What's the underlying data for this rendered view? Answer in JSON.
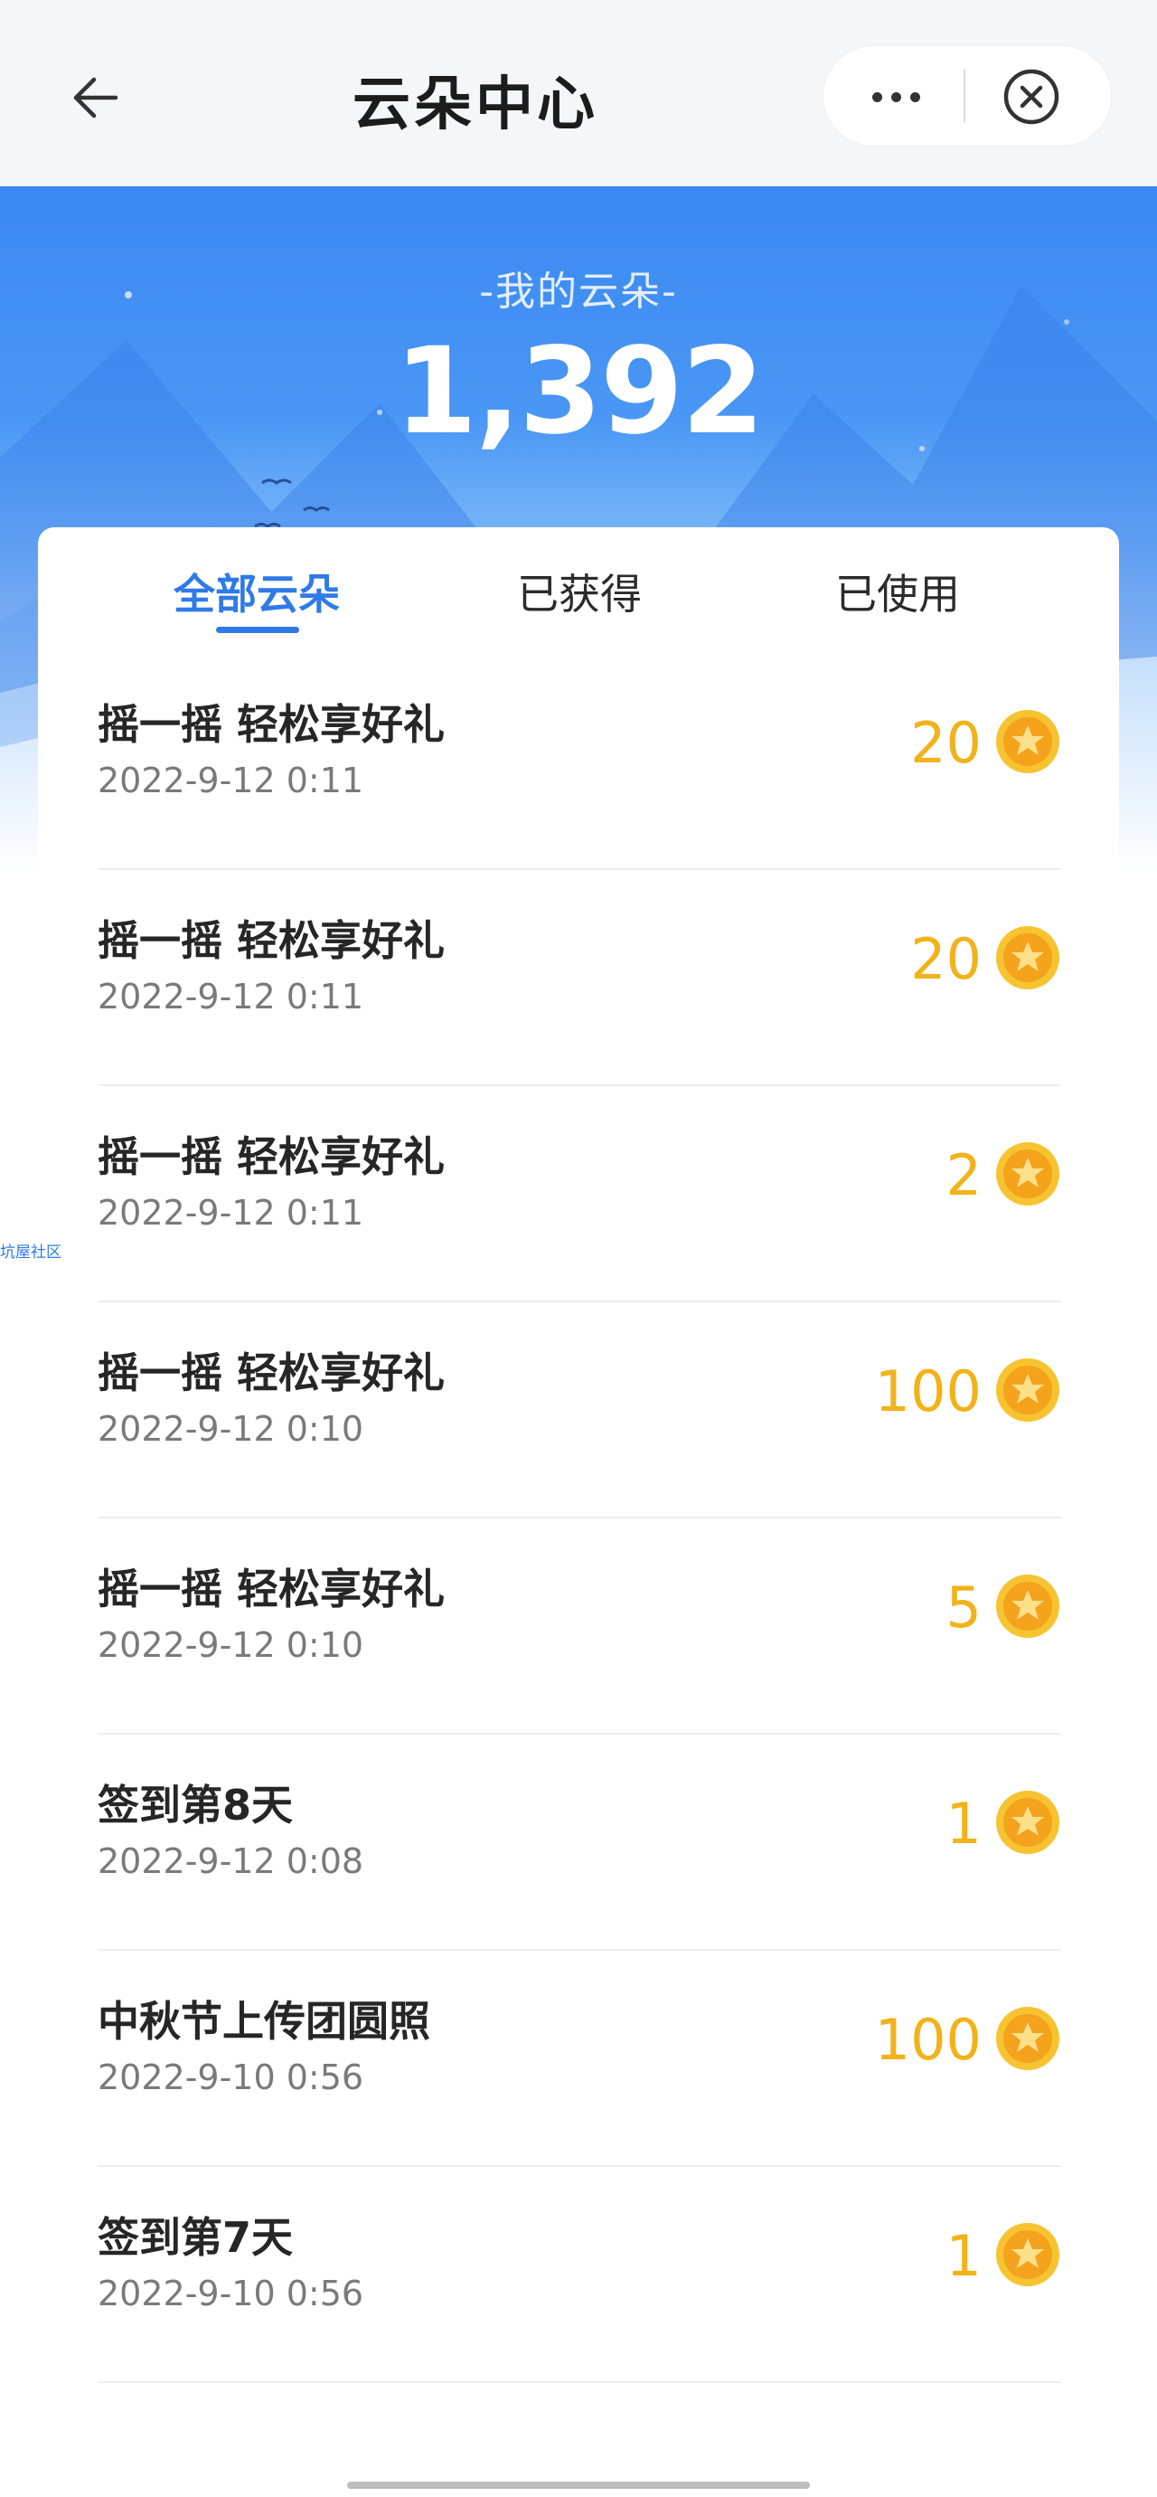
{
  "header": {
    "title": "云朵中心",
    "back_icon": "arrow-left-icon",
    "more_icon": "more-dots-icon",
    "close_icon": "close-circle-icon"
  },
  "balance": {
    "label": "-我的云朵-",
    "value": "1,392"
  },
  "tabs": [
    {
      "label": "全部云朵",
      "active": true
    },
    {
      "label": "已获得",
      "active": false
    },
    {
      "label": "已使用",
      "active": false
    }
  ],
  "records": [
    {
      "title": "摇一摇 轻松享好礼",
      "time": "2022-9-12 0:11",
      "amount": "20"
    },
    {
      "title": "摇一摇 轻松享好礼",
      "time": "2022-9-12 0:11",
      "amount": "20"
    },
    {
      "title": "摇一摇 轻松享好礼",
      "time": "2022-9-12 0:11",
      "amount": "2"
    },
    {
      "title": "摇一摇 轻松享好礼",
      "time": "2022-9-12 0:10",
      "amount": "100"
    },
    {
      "title": "摇一摇 轻松享好礼",
      "time": "2022-9-12 0:10",
      "amount": "5"
    },
    {
      "title": "签到第8天",
      "time": "2022-9-12 0:08",
      "amount": "1"
    },
    {
      "title": "中秋节上传团圆照",
      "time": "2022-9-10 0:56",
      "amount": "100"
    },
    {
      "title": "签到第7天",
      "time": "2022-9-10 0:56",
      "amount": "1"
    }
  ],
  "side_tag": "坑屋社区",
  "colors": {
    "accent_blue": "#2f7ae8",
    "coin_gold": "#f2b21a",
    "hero_blue": "#3b88f2"
  }
}
